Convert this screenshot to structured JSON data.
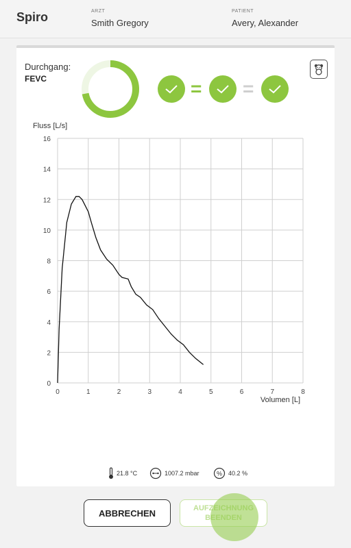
{
  "header": {
    "app_title": "Spiro",
    "doctor_label": "ARZT",
    "doctor_name": "Smith Gregory",
    "patient_label": "PATIENT",
    "patient_name": "Avery, Alexander"
  },
  "measurement": {
    "run_label": "Durchgang:",
    "run_value": "FEVC",
    "progress": 0.72,
    "checks": [
      "check-icon",
      "check-icon",
      "check-icon"
    ],
    "operators": [
      "=",
      "="
    ],
    "kid_mode_icon": "teddy-bear-icon"
  },
  "colors": {
    "accent": "#8dc63f",
    "accent_light": "#c9e5a6",
    "operator_inactive": "#cfcfcf"
  },
  "chart_data": {
    "type": "line",
    "ylabel": "Fluss [L/s]",
    "xlabel": "Volumen [L]",
    "xlim": [
      0,
      8
    ],
    "ylim": [
      0,
      16
    ],
    "x_ticks": [
      0,
      1,
      2,
      3,
      4,
      5,
      6,
      7,
      8
    ],
    "y_ticks": [
      0,
      2,
      4,
      6,
      8,
      10,
      12,
      14,
      16
    ],
    "grid": true,
    "series": [
      {
        "x": [
          0,
          0.05,
          0.15,
          0.3,
          0.45,
          0.6,
          0.7,
          0.8,
          0.9,
          1.0,
          1.1,
          1.25,
          1.4,
          1.6,
          1.8,
          2.0,
          2.1,
          2.3,
          2.4,
          2.55,
          2.7,
          2.9,
          3.1,
          3.3,
          3.5,
          3.7,
          3.9,
          4.1,
          4.3,
          4.5,
          4.75
        ],
        "y": [
          0,
          3.5,
          7.5,
          10.5,
          11.7,
          12.2,
          12.2,
          12.0,
          11.6,
          11.2,
          10.5,
          9.5,
          8.7,
          8.1,
          7.7,
          7.1,
          6.9,
          6.8,
          6.3,
          5.8,
          5.6,
          5.1,
          4.8,
          4.2,
          3.7,
          3.2,
          2.8,
          2.5,
          2.0,
          1.6,
          1.2
        ]
      }
    ]
  },
  "environment": {
    "temperature": "21.8 °C",
    "pressure": "1007.2 mbar",
    "humidity": "40.2 %"
  },
  "actions": {
    "cancel_label": "ABBRECHEN",
    "end_label": "AUFZEICHNUNG\nBEENDEN"
  }
}
